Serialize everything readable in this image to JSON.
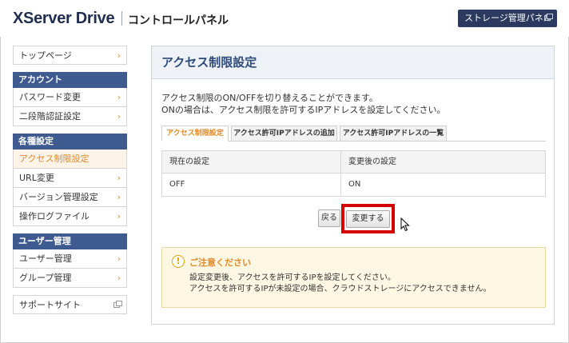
{
  "header": {
    "logo": "XServer Drive",
    "title": "コントロールパネル",
    "storage_button": "ストレージ管理パネル"
  },
  "sidebar": {
    "top": "トップページ",
    "account_head": "アカウント",
    "account_items": [
      "パスワード変更",
      "二段階認証設定"
    ],
    "settings_head": "各種設定",
    "settings_items": [
      "アクセス制限設定",
      "URL変更",
      "バージョン管理設定",
      "操作ログファイル"
    ],
    "settings_active_index": 0,
    "users_head": "ユーザー管理",
    "users_items": [
      "ユーザー管理",
      "グループ管理"
    ],
    "support": "サポートサイト"
  },
  "main": {
    "title": "アクセス制限設定",
    "desc_line1": "アクセス制限のON/OFFを切り替えることができます。",
    "desc_line2": "ONの場合は、アクセス制限を許可するIPアドレスを設定してください。",
    "tabs": [
      "アクセス制限設定",
      "アクセス許可IPアドレスの追加",
      "アクセス許可IPアドレスの一覧"
    ],
    "active_tab": 0,
    "table": {
      "headers": [
        "現在の設定",
        "変更後の設定"
      ],
      "rows": [
        [
          "OFF",
          "ON"
        ]
      ]
    },
    "back_button": "戻る",
    "submit_button": "変更する",
    "notice": {
      "title": "ご注意ください",
      "line1": "設定変更後、アクセスを許可するIPを設定してください。",
      "line2": "アクセスを許可するIPが未設定の場合、クラウドストレージにアクセスできません。"
    }
  },
  "colors": {
    "nav_head": "#3e5a8e",
    "accent": "#e08a2a",
    "highlight": "#d40000"
  }
}
